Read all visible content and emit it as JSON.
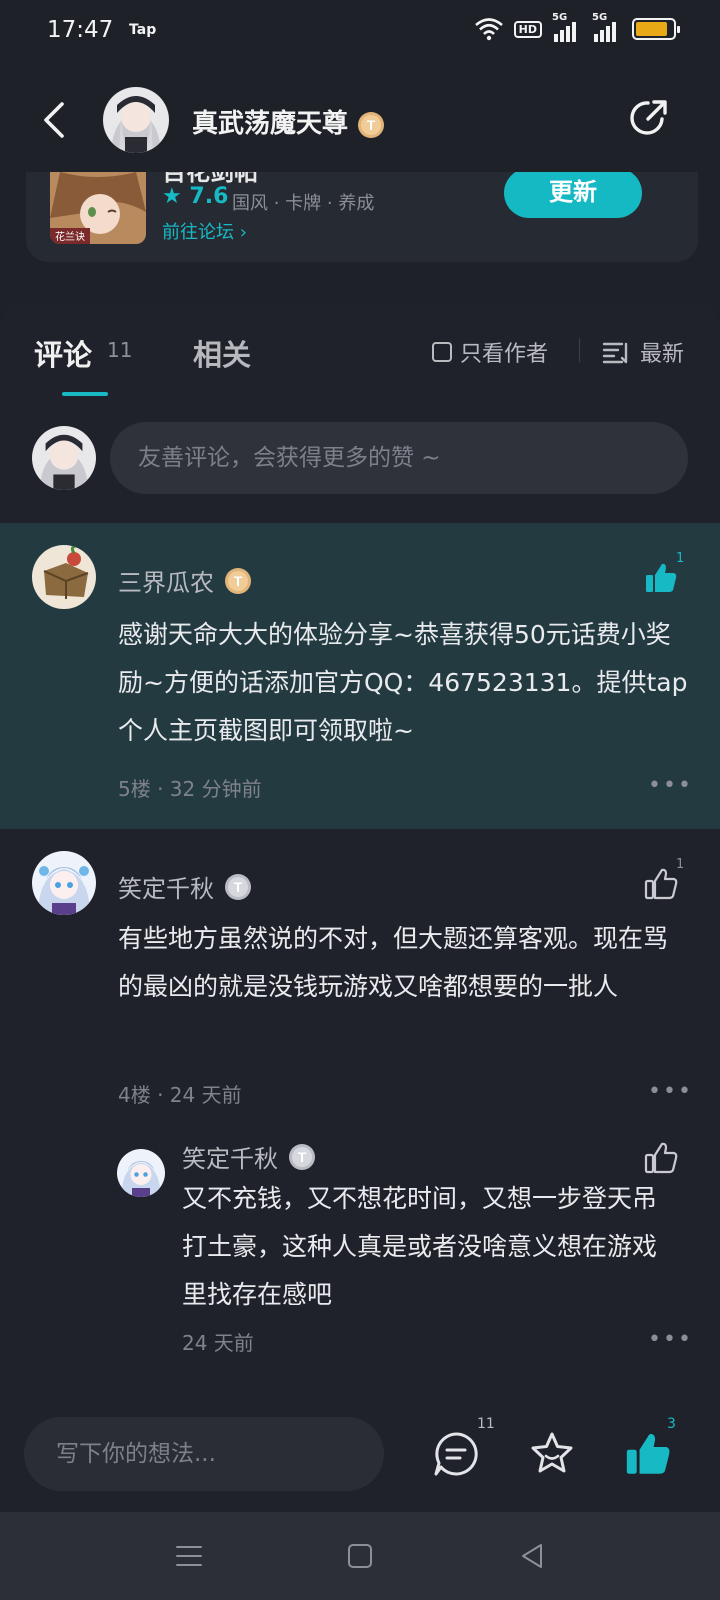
{
  "status_bar": {
    "time": "17:47",
    "app_label": "Tap",
    "hd_label": "HD",
    "sim1_label": "5G",
    "sim2_label": "5G",
    "battery_level": 0.85
  },
  "header": {
    "title": "真武荡魔天尊",
    "level_badge": "T"
  },
  "game": {
    "title_partial": "百花剑帖",
    "cover_text": "花兰诀",
    "rating": "7.6",
    "tags": "国风 · 卡牌 · 养成",
    "forum_link": "前往论坛",
    "update_label": "更新"
  },
  "tabs": {
    "comments_label": "评论",
    "comments_count": "11",
    "related_label": "相关",
    "author_only_label": "只看作者",
    "sort_label": "最新"
  },
  "composer": {
    "placeholder": "友善评论，会获得更多的赞 ~"
  },
  "comments": [
    {
      "name": "三界瓜农",
      "badge": "T",
      "text": "感谢天命大大的体验分享~恭喜获得50元话费小奖励~方便的话添加官方QQ：467523131。提供tap个人主页截图即可领取啦~",
      "meta": "5楼 · 32 分钟前",
      "likes": "1",
      "liked": true
    },
    {
      "name": "笑定千秋",
      "badge": "T",
      "text": "有些地方虽然说的不对，但大题还算客观。现在骂的最凶的就是没钱玩游戏又啥都想要的一批人",
      "meta": "4楼 · 24 天前",
      "likes": "1",
      "liked": false
    }
  ],
  "reply": {
    "name": "笑定千秋",
    "badge": "T",
    "text": "又不充钱，又不想花时间，又想一步登天吊打土豪，这种人真是或者没啥意义想在游戏里找存在感吧",
    "meta": "24 天前"
  },
  "more_glyph": "•••",
  "bottom_bar": {
    "placeholder": "写下你的想法...",
    "comment_count": "11",
    "like_count": "3"
  },
  "colors": {
    "accent": "#16b9c4",
    "background": "#1f2129",
    "highlight": "#223a40"
  }
}
